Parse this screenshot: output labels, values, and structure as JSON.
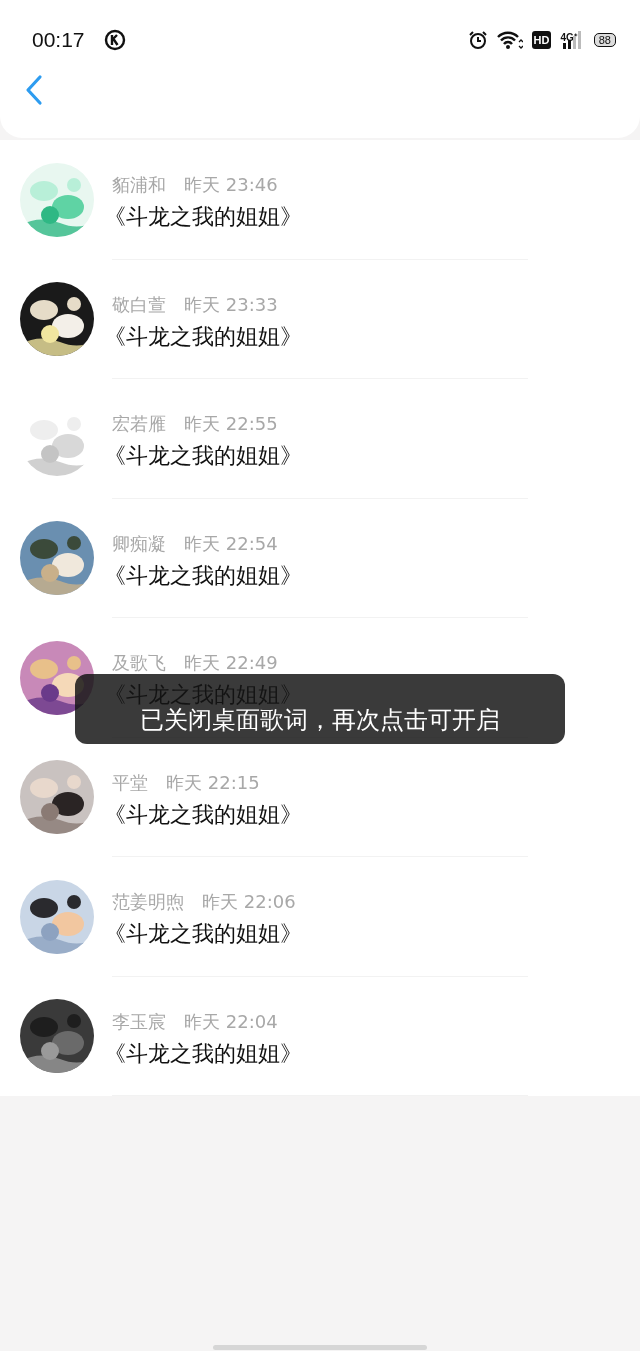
{
  "status_bar": {
    "time": "00:17",
    "network_badge": "HD",
    "network_type": "4G⁺",
    "battery": "88"
  },
  "messages": [
    {
      "name": "貊浦和",
      "time": "昨天 23:46",
      "text": "《斗龙之我的姐姐》"
    },
    {
      "name": "敬白萱",
      "time": "昨天 23:33",
      "text": "《斗龙之我的姐姐》"
    },
    {
      "name": "宏若雁",
      "time": "昨天 22:55",
      "text": "《斗龙之我的姐姐》"
    },
    {
      "name": "卿痴凝",
      "time": "昨天 22:54",
      "text": "《斗龙之我的姐姐》"
    },
    {
      "name": "及歌飞",
      "time": "昨天 22:49",
      "text": "《斗龙之我的姐姐》"
    },
    {
      "name": "平堂",
      "time": "昨天 22:15",
      "text": "《斗龙之我的姐姐》"
    },
    {
      "name": "范姜明煦",
      "time": "昨天 22:06",
      "text": "《斗龙之我的姐姐》"
    },
    {
      "name": "李玉宸",
      "time": "昨天 22:04",
      "text": "《斗龙之我的姐姐》"
    }
  ],
  "toast": {
    "text": "已关闭桌面歌词，再次点击可开启"
  }
}
